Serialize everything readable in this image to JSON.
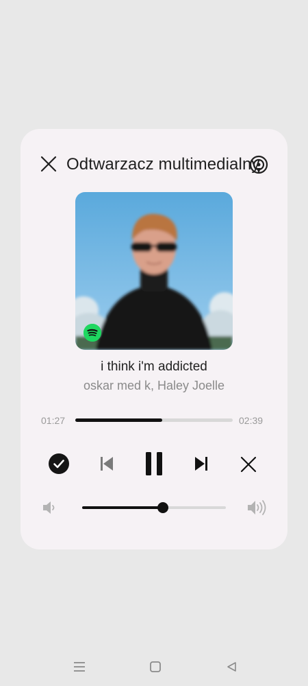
{
  "header": {
    "title": "Odtwarzacz multimedialny",
    "close_icon": "close-icon",
    "cast_icon": "cast-icon"
  },
  "artwork": {
    "badge_icon": "spotify-icon",
    "badge_color": "#1ed760"
  },
  "track": {
    "title": "i think i'm addicted",
    "artist": "oskar med k, Haley Joelle"
  },
  "playback": {
    "elapsed": "01:27",
    "duration": "02:39",
    "progress": 0.55,
    "state": "playing"
  },
  "controls": {
    "like_icon": "check-circle-icon",
    "previous_icon": "skip-previous-icon",
    "pause_icon": "pause-icon",
    "next_icon": "skip-next-icon",
    "dismiss_icon": "close-icon"
  },
  "volume": {
    "level": 0.56,
    "low_icon": "volume-low-icon",
    "high_icon": "volume-high-icon"
  },
  "navigation": {
    "menu_icon": "menu-icon",
    "home_icon": "home-square-icon",
    "back_icon": "back-triangle-icon"
  },
  "colors": {
    "card_background": "#f6f2f5",
    "screen_background": "#e8e8e8",
    "accent": "#111111"
  }
}
